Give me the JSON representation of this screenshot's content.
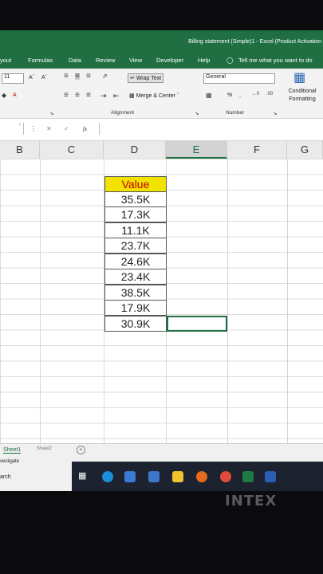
{
  "window": {
    "title": "Billing statement (Simple)1 - Excel (Product Activation"
  },
  "menu": {
    "items": [
      "yout",
      "Formulas",
      "Data",
      "Review",
      "View",
      "Developer",
      "Help"
    ],
    "tell_me": "Tell me what you want to do"
  },
  "ribbon": {
    "font_size": "11",
    "wrap_text": "Wrap Text",
    "merge_center": "Merge & Center",
    "number_format": "General",
    "percent": "%",
    "conditional_formatting": "Conditional Formatting",
    "groups": {
      "alignment": "Alignment",
      "number": "Number"
    }
  },
  "formula_bar": {
    "fx": "fx"
  },
  "columns": [
    "B",
    "C",
    "D",
    "E",
    "F",
    "G"
  ],
  "selected_column": "E",
  "sheet": {
    "header": "Value",
    "values": [
      "35.5K",
      "17.3K",
      "11.1K",
      "23.7K",
      "24.6K",
      "23.4K",
      "38.5K",
      "17.9K",
      "30.9K"
    ]
  },
  "tabs": {
    "sheet1": "Sheet1",
    "sheet2": "Sheet2",
    "status1": "vestigate",
    "status2": "arch"
  },
  "device_brand": "INTEX",
  "colors": {
    "excel_green": "#1f6f43",
    "header_fill": "#f2e200",
    "header_text": "#c00000"
  }
}
